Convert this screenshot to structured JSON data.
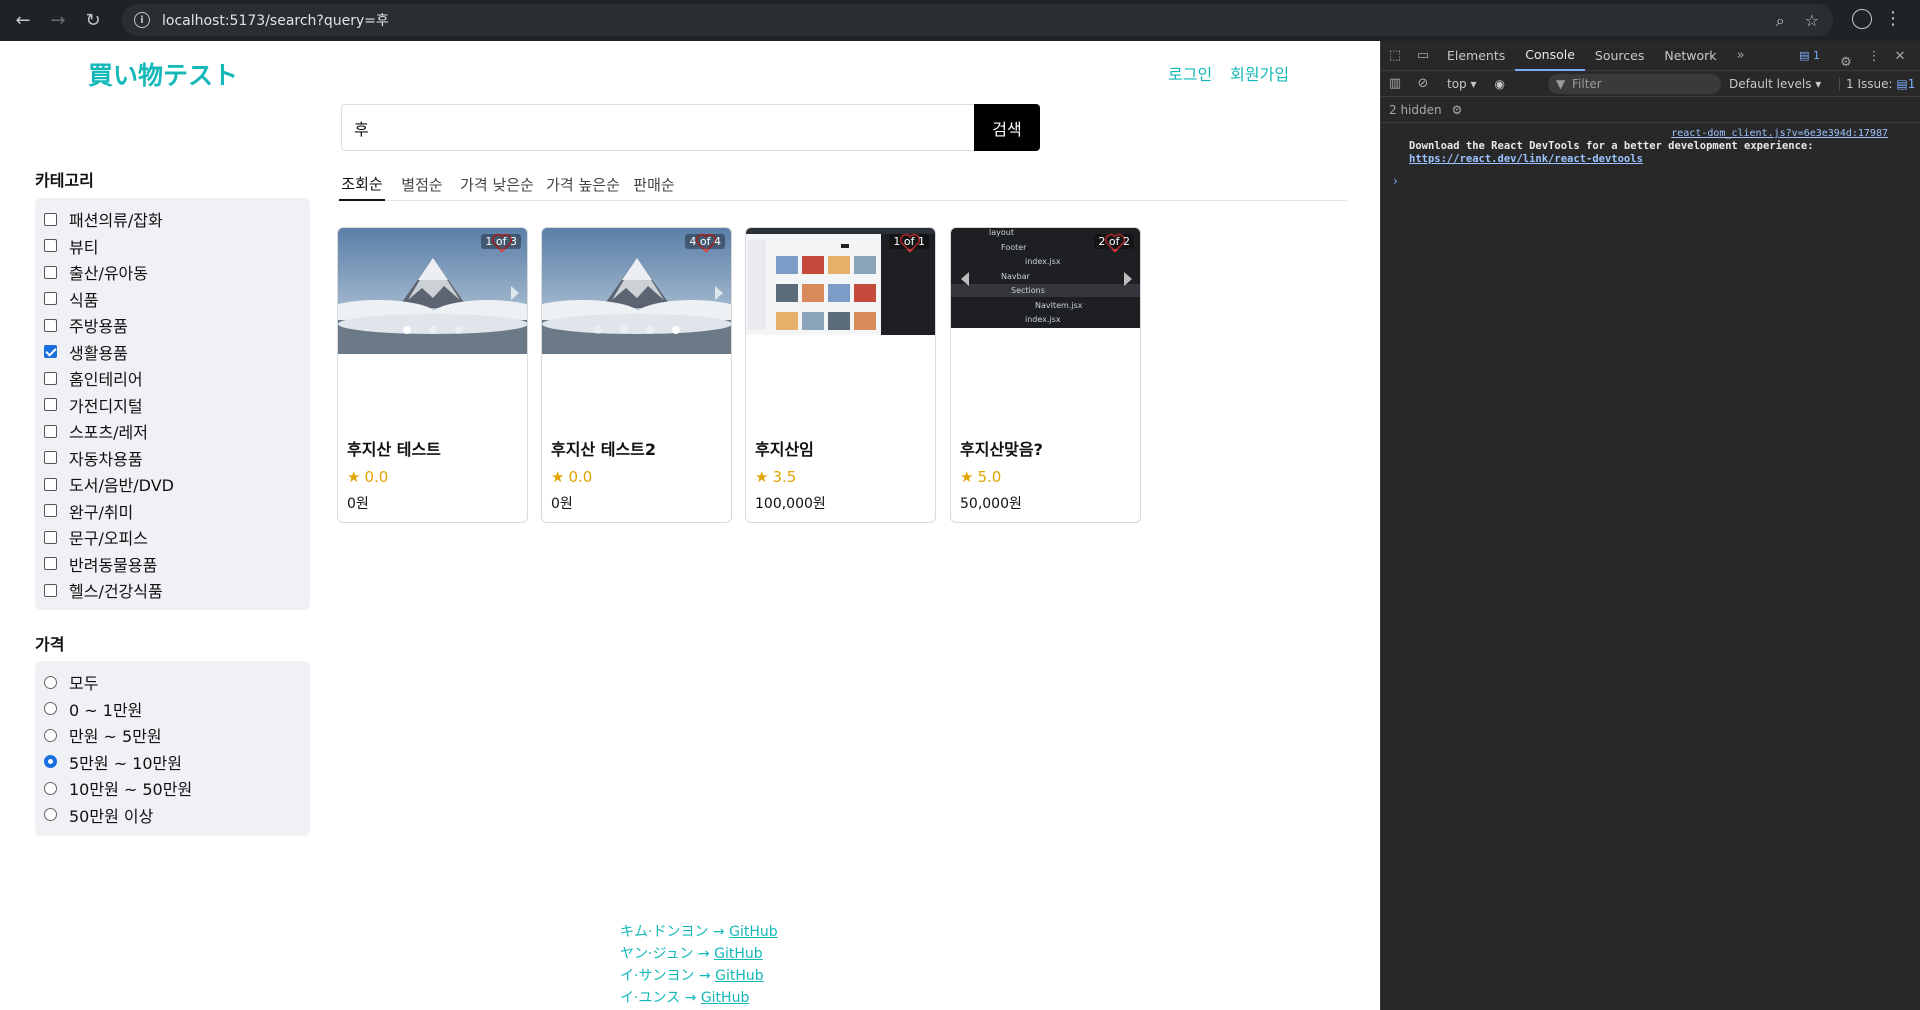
{
  "browser": {
    "url": "localhost:5173/search?query=후"
  },
  "header": {
    "logo": "買い物テスト",
    "login": "로그인",
    "signup": "회원가입"
  },
  "search": {
    "value": "후",
    "button": "검색"
  },
  "sidebar": {
    "category_title": "카테고리",
    "categories": [
      {
        "label": "패션의류/잡화",
        "checked": false
      },
      {
        "label": "뷰티",
        "checked": false
      },
      {
        "label": "출산/유아동",
        "checked": false
      },
      {
        "label": "식품",
        "checked": false
      },
      {
        "label": "주방용품",
        "checked": false
      },
      {
        "label": "생활용품",
        "checked": true
      },
      {
        "label": "홈인테리어",
        "checked": false
      },
      {
        "label": "가전디지털",
        "checked": false
      },
      {
        "label": "스포츠/레저",
        "checked": false
      },
      {
        "label": "자동차용품",
        "checked": false
      },
      {
        "label": "도서/음반/DVD",
        "checked": false
      },
      {
        "label": "완구/취미",
        "checked": false
      },
      {
        "label": "문구/오피스",
        "checked": false
      },
      {
        "label": "반려동물용품",
        "checked": false
      },
      {
        "label": "헬스/건강식품",
        "checked": false
      }
    ],
    "price_title": "가격",
    "prices": [
      {
        "label": "모두",
        "checked": false
      },
      {
        "label": "0 ~ 1만원",
        "checked": false
      },
      {
        "label": "만원 ~ 5만원",
        "checked": false
      },
      {
        "label": "5만원 ~ 10만원",
        "checked": true
      },
      {
        "label": "10만원 ~ 50만원",
        "checked": false
      },
      {
        "label": "50만원 이상",
        "checked": false
      }
    ]
  },
  "sort_tabs": [
    {
      "label": "조회순",
      "active": true
    },
    {
      "label": "별점순",
      "active": false
    },
    {
      "label": "가격 낮은순",
      "active": false
    },
    {
      "label": "가격 높은순",
      "active": false
    },
    {
      "label": "판매순",
      "active": false
    }
  ],
  "products": [
    {
      "name": "후지산 테스트",
      "rating": "0.0",
      "price": "0원",
      "counter": "1 of 3",
      "dots": 3,
      "active_dot": 0,
      "image": "mountain"
    },
    {
      "name": "후지산 테스트2",
      "rating": "0.0",
      "price": "0원",
      "counter": "4 of 4",
      "dots": 4,
      "active_dot": 3,
      "image": "mountain"
    },
    {
      "name": "후지산임",
      "rating": "3.5",
      "price": "100,000원",
      "counter": "1 of 1",
      "dots": 0,
      "active_dot": 0,
      "image": "screenshot"
    },
    {
      "name": "후지산맞음?",
      "rating": "5.0",
      "price": "50,000원",
      "counter": "2 of 2",
      "dots": 0,
      "active_dot": 0,
      "image": "filetree"
    }
  ],
  "filetree_lines": [
    "layout",
    "Footer",
    "index.jsx",
    "Navbar",
    "Sections",
    "NavItem.jsx",
    "index.jsx"
  ],
  "footer": [
    {
      "name": "キム·ドンヨン",
      "link": "GitHub"
    },
    {
      "name": "ヤン·ジュン",
      "link": "GitHub"
    },
    {
      "name": "イ·サンヨン",
      "link": "GitHub"
    },
    {
      "name": "イ·ユンス",
      "link": "GitHub"
    }
  ],
  "devtools": {
    "tabs": [
      "Elements",
      "Console",
      "Sources",
      "Network"
    ],
    "active_tab": "Console",
    "messages_badge": "1",
    "context": "top",
    "filter_placeholder": "Filter",
    "levels": "Default levels",
    "issues": "1 Issue:",
    "issues_count": "1",
    "hidden": "2 hidden",
    "message_source": "react-dom_client.js?v=6e3e394d:17987",
    "message_text": "Download the React DevTools for a better development experience:",
    "message_link": "https://react.dev/link/react-devtools"
  },
  "colors": {
    "brand": "#14b8b8",
    "star": "#e2a400",
    "checkbox": "#1a6fe0"
  }
}
